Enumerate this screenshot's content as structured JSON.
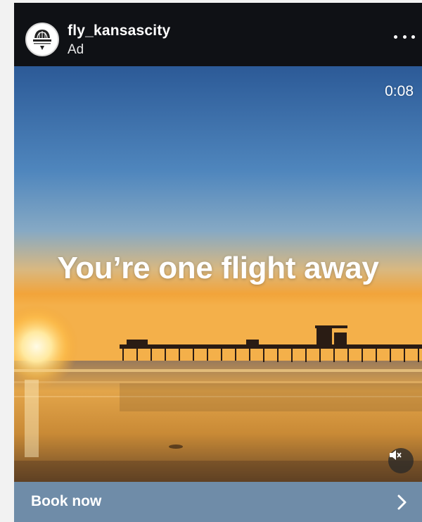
{
  "post": {
    "account_name": "fly_kansascity",
    "sponsored_label": "Ad",
    "avatar_icon": "kansas-city-airport-logo-icon",
    "more_icon": "more-options-icon"
  },
  "media": {
    "timer": "0:08",
    "headline": "You’re one flight away",
    "mute_icon": "speaker-muted-icon"
  },
  "cta": {
    "label": "Book now",
    "chevron_icon": "chevron-right-icon"
  },
  "colors": {
    "header_bg": "#0f1115",
    "cta_bg": "#6f8ca8",
    "sky_top": "#2c5a97",
    "sunset": "#f3a432"
  }
}
